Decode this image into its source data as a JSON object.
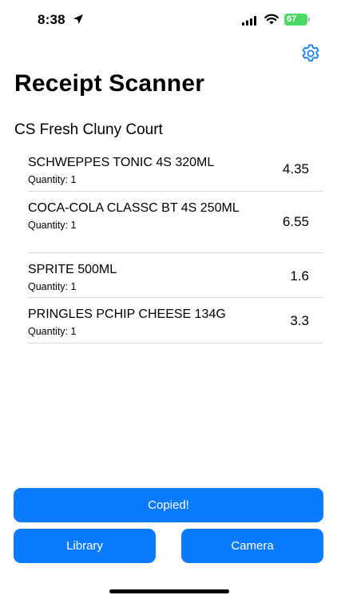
{
  "status_bar": {
    "time": "8:38",
    "battery": "67",
    "icons": [
      "location-arrow-icon",
      "signal-icon",
      "wifi-icon",
      "battery-charging-icon"
    ]
  },
  "header": {
    "settings_icon": "gear-icon",
    "title": "Receipt Scanner"
  },
  "store_name": "CS Fresh Cluny Court",
  "items": [
    {
      "name": "SCHWEPPES TONIC 4S 320ML",
      "quantity": "Quantity: 1",
      "price": "4.35"
    },
    {
      "name": "COCA-COLA CLASSC BT 4S 250ML",
      "quantity": "Quantity: 1",
      "price": "6.55"
    },
    {
      "name": "SPRITE 500ML",
      "quantity": "Quantity: 1",
      "price": "1.6"
    },
    {
      "name": "PRINGLES PCHIP CHEESE 134G",
      "quantity": "Quantity: 1",
      "price": "3.3"
    }
  ],
  "buttons": {
    "copy": "Copied!",
    "library": "Library",
    "camera": "Camera"
  },
  "colors": {
    "accent": "#0a7aff",
    "battery": "#4cd964",
    "divider": "#d9d9de"
  }
}
